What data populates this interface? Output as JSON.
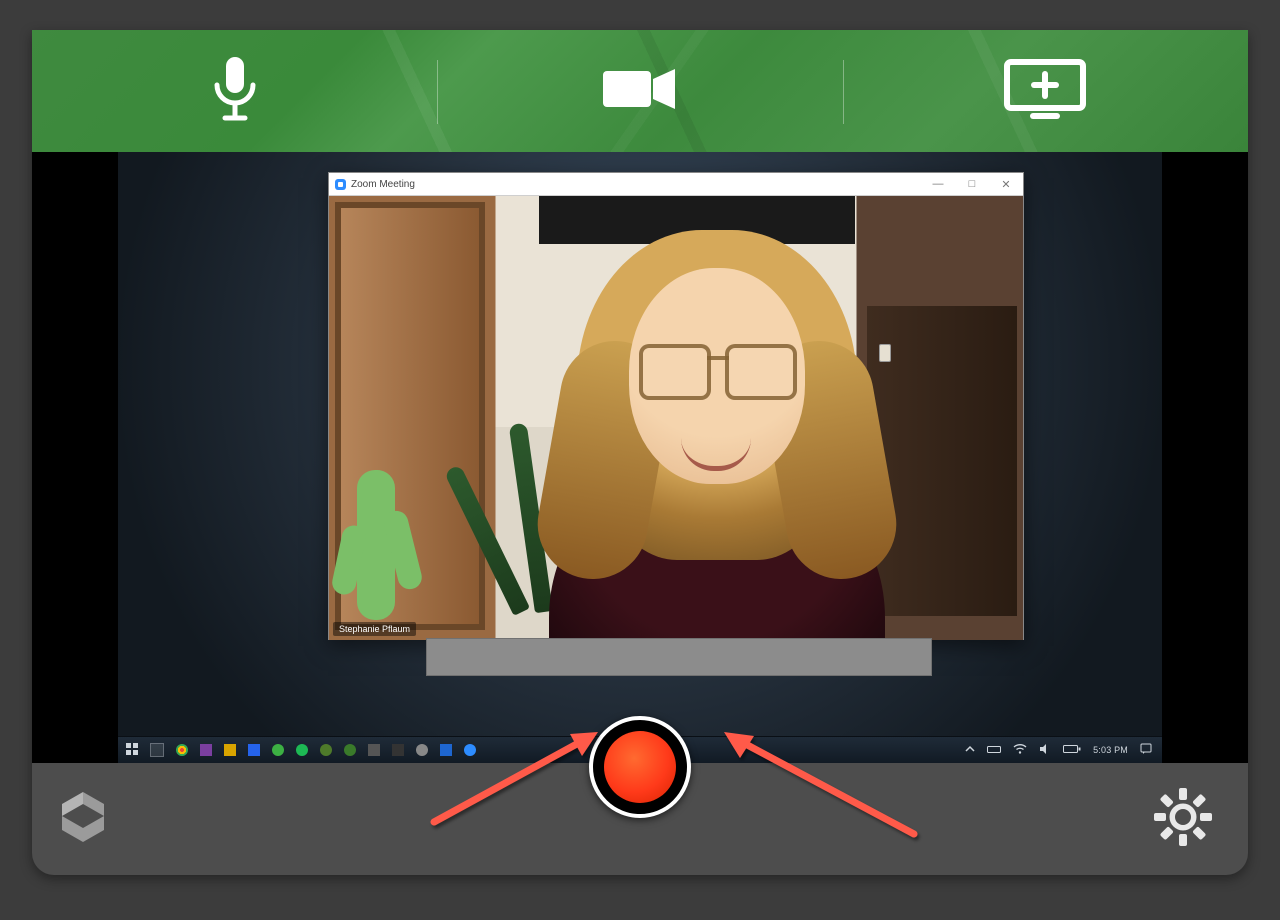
{
  "toolbar": {
    "mic_icon": "microphone-icon",
    "video_icon": "video-camera-icon",
    "screen_icon": "add-screen-icon"
  },
  "zoom": {
    "title": "Zoom Meeting",
    "participant_name": "Stephanie Pflaum",
    "minimize": "—",
    "maximize": "□",
    "close": "✕"
  },
  "taskbar": {
    "time": "5:03 PM"
  },
  "controls": {
    "record_label": "Record",
    "settings_label": "Settings",
    "library_label": "Library"
  }
}
